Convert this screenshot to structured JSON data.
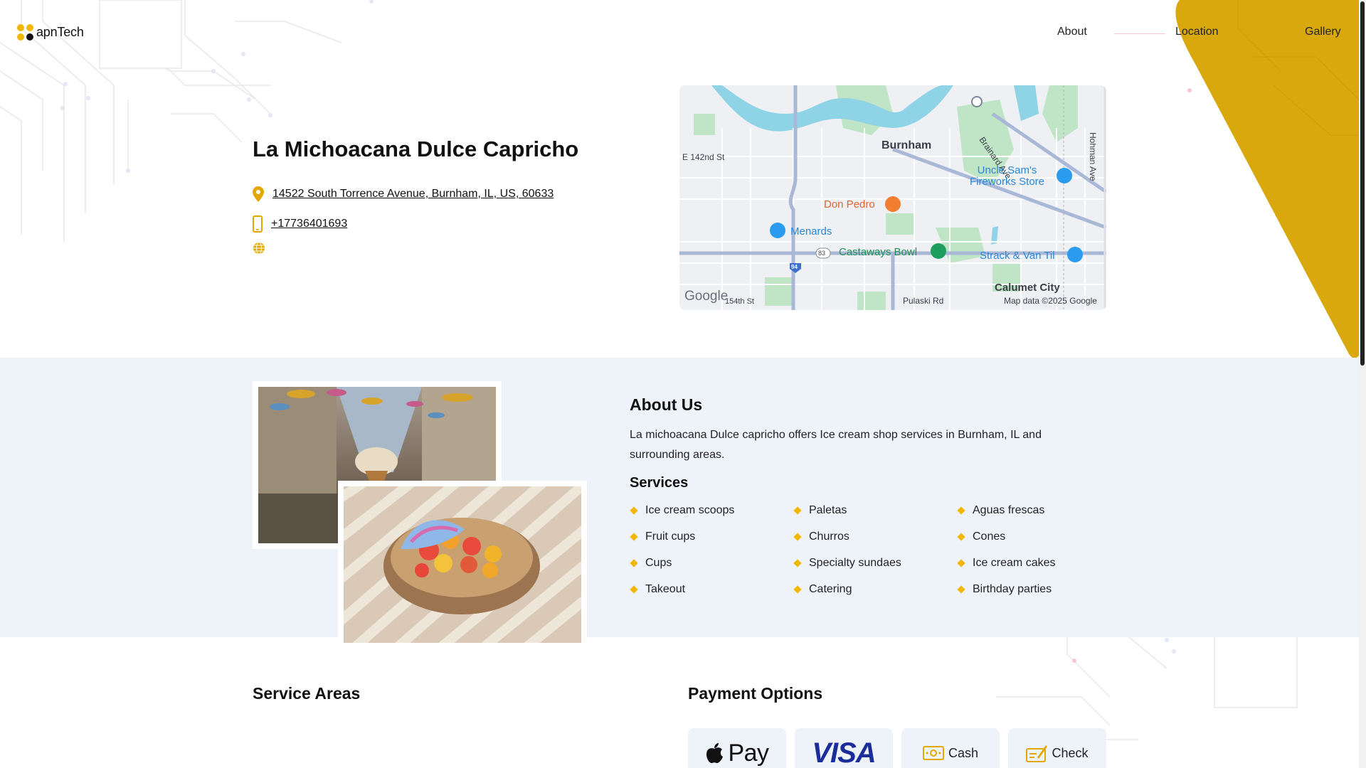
{
  "brand": {
    "logo_text": "apnTech"
  },
  "nav": {
    "about": "About",
    "location": "Location",
    "gallery": "Gallery"
  },
  "business": {
    "name": "La Michoacana Dulce Capricho",
    "address": "14522 South Torrence Avenue, Burnham, IL, US, 60633",
    "phone": "+17736401693"
  },
  "map": {
    "labels": {
      "burnham": "Burnham",
      "e142": "E 142nd St",
      "brainard": "Brainard Ave",
      "hohman": "Hohman Ave",
      "uncle_sams": "Uncle Sam's\nFireworks Store",
      "don_pedro": "Don Pedro",
      "menards": "Menards",
      "castaways": "Castaways Bowl",
      "strack": "Strack & Van Til",
      "calumet": "Calumet City",
      "st154": "154th St",
      "pulaski": "Pulaski Rd",
      "route83": "83",
      "route94": "94",
      "google": "Google",
      "attribution": "Map data ©2025 Google"
    }
  },
  "about": {
    "title": "About Us",
    "text": "La michoacana Dulce capricho offers Ice cream shop services in Burnham, IL and surrounding areas.",
    "services_title": "Services",
    "services": [
      "Ice cream scoops",
      "Paletas",
      "Aguas frescas",
      "Fruit cups",
      "Churros",
      "Cones",
      "Cups",
      "Specialty sundaes",
      "Ice cream cakes",
      "Takeout",
      "Catering",
      "Birthday parties"
    ]
  },
  "service_areas": {
    "title": "Service Areas"
  },
  "payment": {
    "title": "Payment Options",
    "apple_pay": "Pay",
    "visa": "VISA",
    "cash": "Cash",
    "check": "Check"
  },
  "colors": {
    "accent": "#f2b705",
    "band": "#eef3fa",
    "visa": "#1a2d9a"
  },
  "icons": [
    "map-pin-icon",
    "phone-icon",
    "globe-icon",
    "apple-icon",
    "cash-icon",
    "check-icon"
  ]
}
